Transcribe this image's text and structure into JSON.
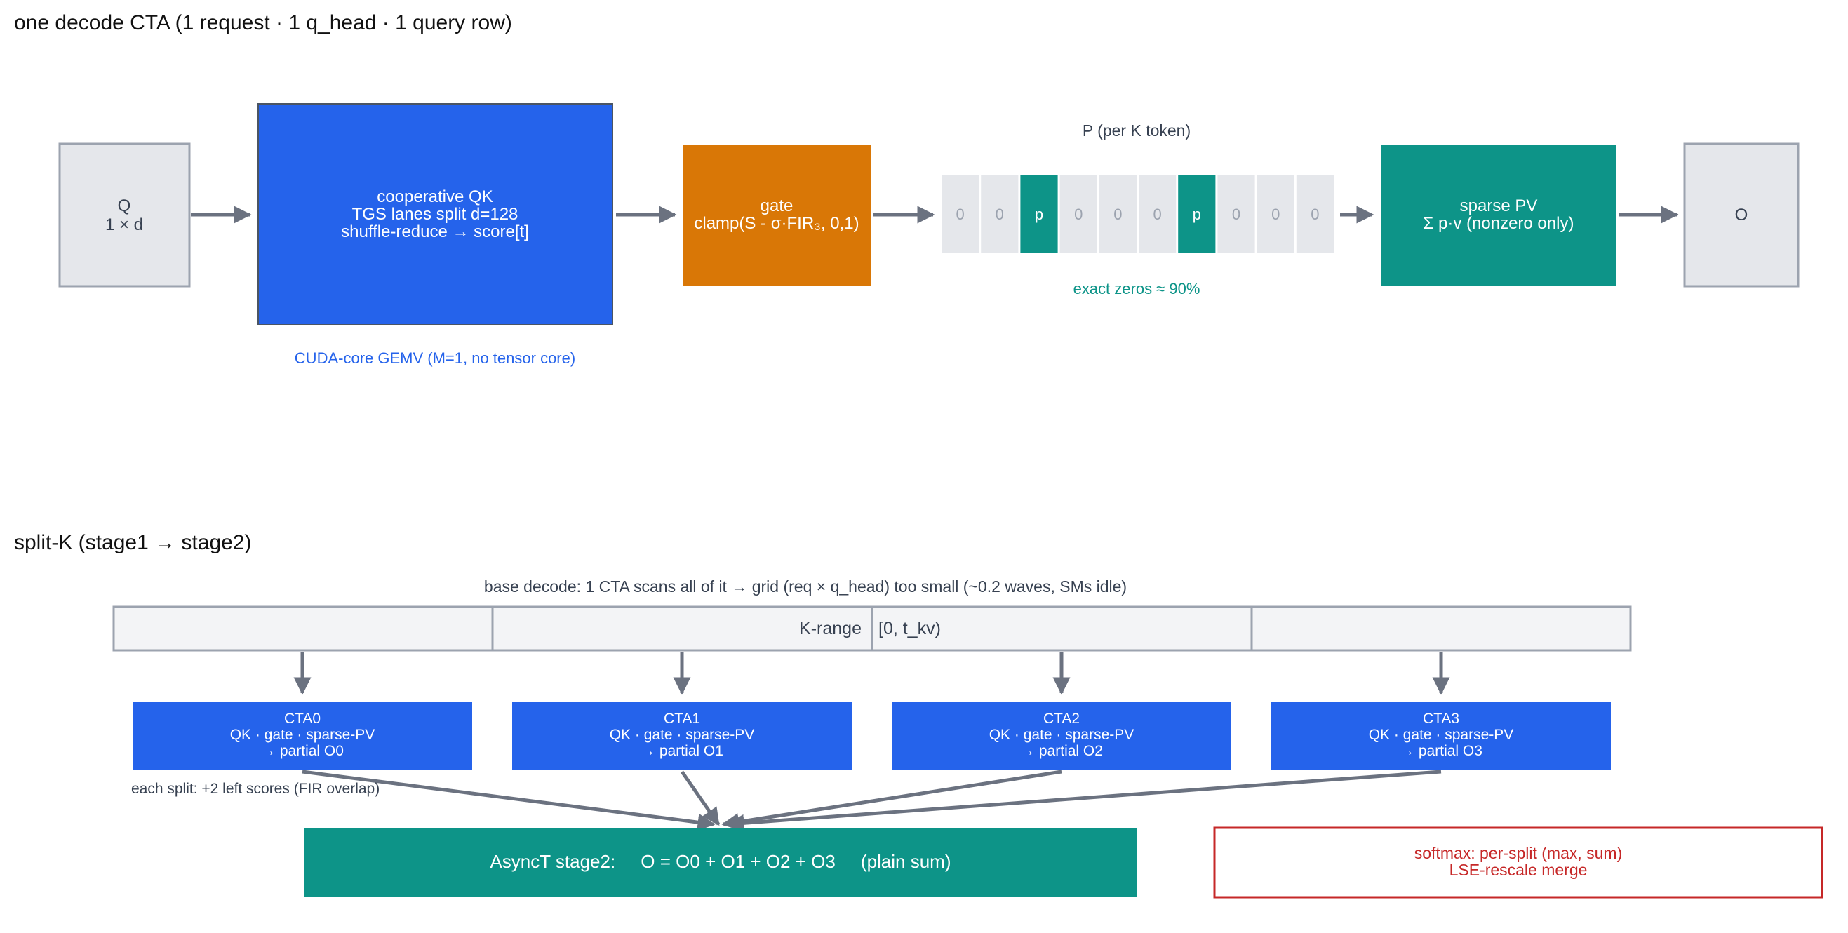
{
  "section1": {
    "title": "one decode CTA  (1 request · 1 q_head · 1 query row)",
    "q_box": {
      "lines": [
        "Q",
        "1 × d"
      ]
    },
    "qk_box": {
      "lines": [
        "cooperative QK",
        "TGS lanes split d=128",
        "shuffle-reduce → score[t]"
      ]
    },
    "qk_caption": "CUDA-core GEMV  (M=1, no tensor core)",
    "gate_box": {
      "lines": [
        "gate",
        "clamp(S - σ·FIR₃, 0,1)"
      ]
    },
    "p_vector": {
      "label": "P  (per K token)",
      "cells": [
        "0",
        "0",
        "p",
        "0",
        "0",
        "0",
        "p",
        "0",
        "0",
        "0"
      ],
      "caption": "exact zeros ≈ 90%"
    },
    "pv_box": {
      "lines": [
        "sparse PV",
        "Σ p·v  (nonzero only)"
      ]
    },
    "o_box": {
      "lines": [
        "O"
      ]
    }
  },
  "section2": {
    "title": "split-K  (stage1 → stage2)",
    "base_note": "base decode: 1 CTA scans all of it  →  grid (req × q_head) too small (~0.2 waves, SMs idle)",
    "krange_label": "K-range",
    "krange_value": "[0, t_kv)",
    "ctas": [
      {
        "lines": [
          "CTA0",
          "QK · gate · sparse-PV",
          "→ partial O0"
        ]
      },
      {
        "lines": [
          "CTA1",
          "QK · gate · sparse-PV",
          "→ partial O1"
        ]
      },
      {
        "lines": [
          "CTA2",
          "QK · gate · sparse-PV",
          "→ partial O2"
        ]
      },
      {
        "lines": [
          "CTA3",
          "QK · gate · sparse-PV",
          "→ partial O3"
        ]
      }
    ],
    "overlap_note": "each split: +2 left scores (FIR overlap)",
    "stage2": "AsyncT stage2:     O = O0 + O1 + O2 + O3     (plain sum)",
    "softmax_box": {
      "lines": [
        "softmax:  per-split (max, sum)",
        "LSE-rescale merge"
      ]
    }
  },
  "colors": {
    "blue": "#2563eb",
    "orange": "#d97706",
    "teal": "#0d9488",
    "gray_box": "#e5e7eb",
    "gray_stroke": "#9ca3af",
    "arrow": "#6b7280",
    "red": "#c62828",
    "text_dark": "#111111"
  }
}
